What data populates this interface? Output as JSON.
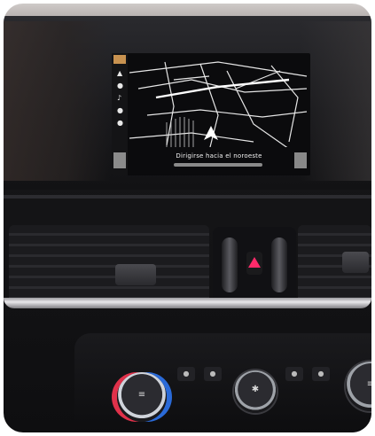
{
  "scene": {
    "description_colors": {
      "map_background": "#0b0b0d",
      "map_lines": "#e6e6e6",
      "hazard_accent": "#ff2a6a",
      "knob_warm": "#e0314a",
      "knob_cool": "#2a6ad8"
    }
  },
  "screen": {
    "caption": "Dirigirse hacia el noroeste",
    "side_icons": [
      "car-icon",
      "menu-icon",
      "music-icon",
      "phone-icon",
      "settings-icon"
    ],
    "corner_left_top": "",
    "corner_right_top": ""
  },
  "console": {
    "hazard_icon": "hazard-triangle-icon"
  }
}
